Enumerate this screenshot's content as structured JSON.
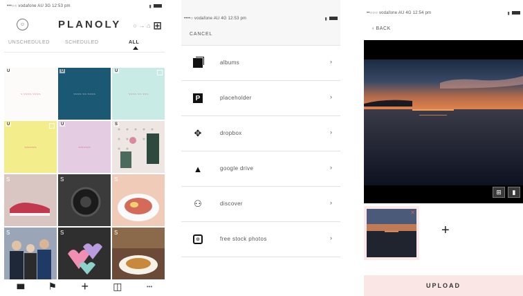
{
  "grid_screen": {
    "status": {
      "left": "•••○○ vodafone AU  3G  12:53 pm",
      "right": "▮"
    },
    "header": {
      "avatar": "☺",
      "logo": "PLANOLY",
      "icons": "○ → ⌂",
      "grid_icon": "⊞"
    },
    "tabs": [
      {
        "label": "UNSCHEDULED"
      },
      {
        "label": "SCHEDULED"
      },
      {
        "label": "ALL"
      }
    ],
    "cells": [
      {
        "badge": "U",
        "text": "~ ~~~~ ~~~~",
        "text_color": "#d9457a"
      },
      {
        "badge": "U",
        "text": "~~~~ ~~ ~~~~",
        "text_color": "#e9e9e9"
      },
      {
        "badge": "U",
        "text": "~~~~ ~~ ~~~",
        "text_color": "#c0607d"
      },
      {
        "badge": "U",
        "text": "~~~~~",
        "text_color": "#d9457a"
      },
      {
        "badge": "U",
        "text": "~~~~~",
        "text_color": "#d9457a"
      },
      {
        "badge": "S",
        "text": ""
      },
      {
        "badge": "S",
        "text": ""
      },
      {
        "badge": "S",
        "text": ""
      },
      {
        "badge": "S",
        "text": ""
      },
      {
        "badge": "S",
        "text": ""
      },
      {
        "badge": "S",
        "text": ""
      },
      {
        "badge": "S",
        "text": ""
      }
    ],
    "toolbar": {
      "grid": "▮▮▮",
      "flag": "⚑",
      "add": "+",
      "calendar": "◫",
      "more": "•••"
    }
  },
  "menu_screen": {
    "status": {
      "left": "••••○ vodafone AU  4G  12:53 pm",
      "right": "▮"
    },
    "cancel": "CANCEL",
    "items": [
      {
        "label": "albums",
        "icon": "albums-icon"
      },
      {
        "label": "placeholder",
        "icon": "placeholder-icon",
        "glyph": "P"
      },
      {
        "label": "dropbox",
        "icon": "dropbox-icon",
        "glyph": "✥"
      },
      {
        "label": "google drive",
        "icon": "google-drive-icon",
        "glyph": "▲"
      },
      {
        "label": "discover",
        "icon": "binoculars-icon",
        "glyph": "⚇"
      },
      {
        "label": "free stock photos",
        "icon": "camera-icon",
        "glyph": "⊙"
      }
    ],
    "chevron": "›"
  },
  "upload_screen": {
    "status": {
      "left": "••○○○ vodafone AU  4G  12:54 pm",
      "right": "▮"
    },
    "back": "‹ BACK",
    "tools": {
      "crop": "⊞",
      "square": "▮"
    },
    "thumb_remove": "✕",
    "add": "+",
    "upload_label": "UPLOAD"
  }
}
